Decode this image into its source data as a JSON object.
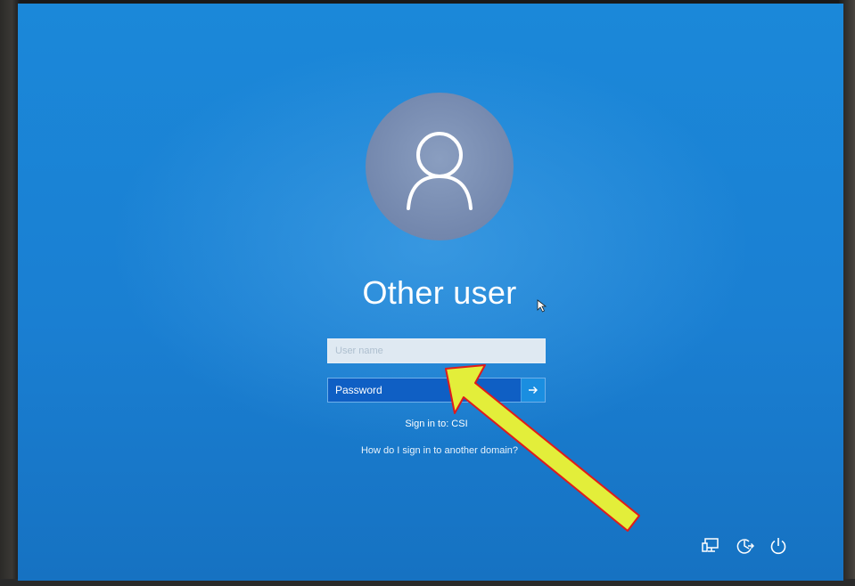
{
  "login": {
    "title": "Other user",
    "username_placeholder": "User name",
    "password_placeholder": "Password",
    "sign_in_to": "Sign in to: CSI",
    "domain_help_link": "How do I sign in to another domain?"
  },
  "tray": {
    "icons": [
      "network-icon",
      "ease-of-access-icon",
      "power-icon"
    ]
  },
  "colors": {
    "screen_blue": "#1a7fd2",
    "avatar": "#7387ad",
    "password_field": "#0f5fc4",
    "annotation_arrow_fill": "#e3ee3a",
    "annotation_arrow_stroke": "#e01b1b"
  }
}
